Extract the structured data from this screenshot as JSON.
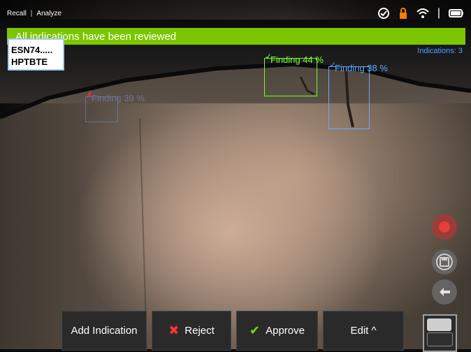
{
  "menu": {
    "recall": "Recall",
    "analyze": "Analyze"
  },
  "banner": {
    "message": "All indications have been reviewed"
  },
  "info_box": {
    "line1": "ESN74.....",
    "line2": "HPTBTE"
  },
  "indications": {
    "label": "Indications: 3"
  },
  "findings": [
    {
      "label": "Finding 44 %",
      "status": "approved",
      "color": "#6bff2e"
    },
    {
      "label": "Finding 38 %",
      "status": "approved",
      "color": "#5aa8ff"
    },
    {
      "label": "Finding 39 %",
      "status": "rejected",
      "color": "#ff2e2e"
    }
  ],
  "toolbar": {
    "add_label": "Add Indication",
    "reject_label": "Reject",
    "approve_label": "Approve",
    "edit_label": "Edit ^"
  },
  "icons": {
    "sync": "sync-icon",
    "lock": "lock-icon",
    "wifi": "wifi-icon",
    "battery": "battery-icon",
    "record": "record-icon",
    "save": "save-icon",
    "back": "back-arrow-icon",
    "layout": "layout-toggle-icon"
  },
  "colors": {
    "banner": "#7cc600",
    "accent_blue": "#4aa3ff",
    "approve_green": "#7ed321",
    "reject_red": "#ff3434"
  }
}
